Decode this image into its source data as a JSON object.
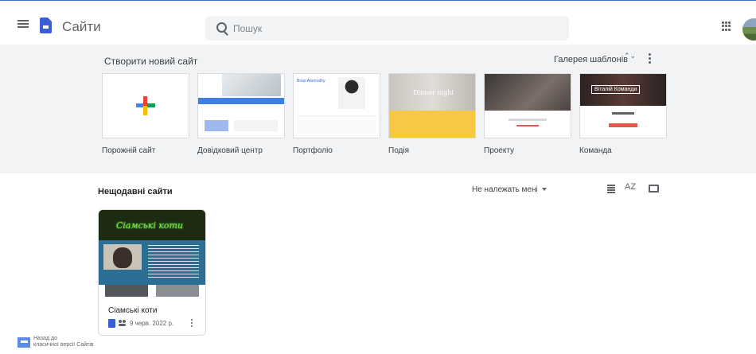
{
  "header": {
    "app_title": "Сайти",
    "search_placeholder": "Пошук",
    "icons": [
      "menu-icon",
      "sites-logo-icon",
      "search-icon",
      "apps-icon",
      "avatar"
    ]
  },
  "templates": {
    "title": "Створити новий сайт",
    "gallery_label": "Галерея шаблонів",
    "chevron": "⌃⌄",
    "items": [
      {
        "label": "Порожній сайт"
      },
      {
        "label": "Довідковий центр"
      },
      {
        "label": "Портфоліо",
        "thumb_text": "Brian Abernathy"
      },
      {
        "label": "Подія",
        "thumb_text": "Dinner night"
      },
      {
        "label": "Проекту"
      },
      {
        "label": "Команда",
        "thumb_text": "Віталій Команди"
      }
    ]
  },
  "recent": {
    "title": "Нещодавні сайти",
    "owner_filter": "Не належать мені",
    "sort_icon_text": "AZ",
    "sites": [
      {
        "name": "Сіамські коти",
        "thumb_title": "Сіамські коти",
        "date": "9 черв. 2022 р."
      }
    ]
  },
  "footer": {
    "legacy_link": [
      "Назад до",
      "класичної версії Сайтів"
    ]
  },
  "colors": {
    "accent": "#3b5ed6",
    "template_bg": "#f1f3f4",
    "site_hero_text": "#7fe340",
    "event_yellow": "#f6c843"
  }
}
